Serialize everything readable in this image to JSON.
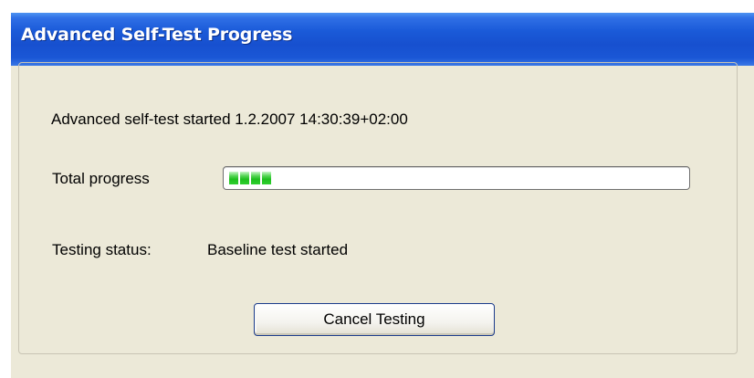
{
  "window": {
    "title": "Advanced Self-Test Progress"
  },
  "body": {
    "started_text": "Advanced self-test started 1.2.2007 14:30:39+02:00",
    "progress_label": "Total progress",
    "progress_value": 0.12,
    "progress_chunks": 4,
    "progress_color": "#1fbf1f",
    "status_label": "Testing status:",
    "status_value": "Baseline test started"
  },
  "buttons": {
    "cancel_label": "Cancel Testing"
  },
  "colors": {
    "titlebar": "#1a57d6",
    "dialog_background": "#ece9d8",
    "button_border": "#1c3c8c"
  }
}
